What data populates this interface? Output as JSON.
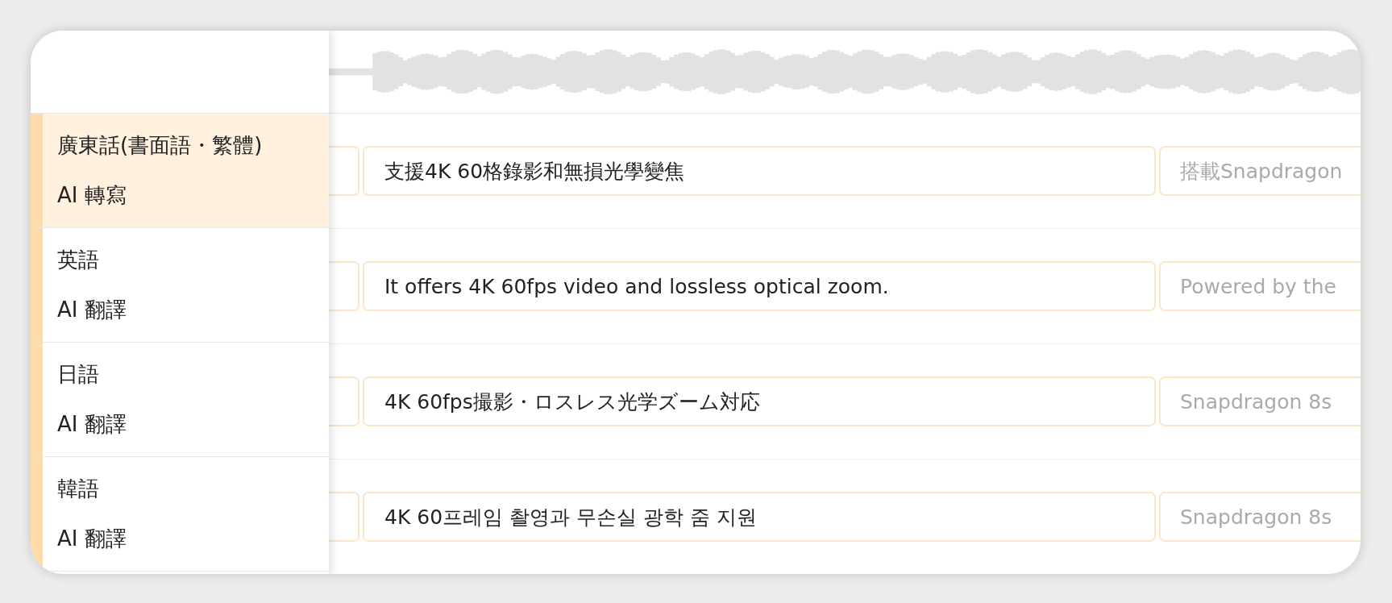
{
  "languages": [
    {
      "name": "廣東話(書面語・繁體)",
      "mode": "AI 轉寫",
      "selected": true
    },
    {
      "name": "英語",
      "mode": "AI 翻譯",
      "selected": false
    },
    {
      "name": "日語",
      "mode": "AI 翻譯",
      "selected": false
    },
    {
      "name": "韓語",
      "mode": "AI 翻譯",
      "selected": false
    }
  ],
  "rows": [
    {
      "text": "支援4K 60格錄影和無損光學變焦",
      "next_text": "搭載Snapdragon"
    },
    {
      "text": "It offers 4K 60fps video and lossless optical zoom.",
      "next_text": "Powered by the"
    },
    {
      "text": "4K 60fps撮影・ロスレス光学ズーム対応",
      "next_text": "Snapdragon 8s"
    },
    {
      "text": "4K 60프레임 촬영과 무손실 광학 줌 지원",
      "next_text": "Snapdragon 8s"
    }
  ]
}
